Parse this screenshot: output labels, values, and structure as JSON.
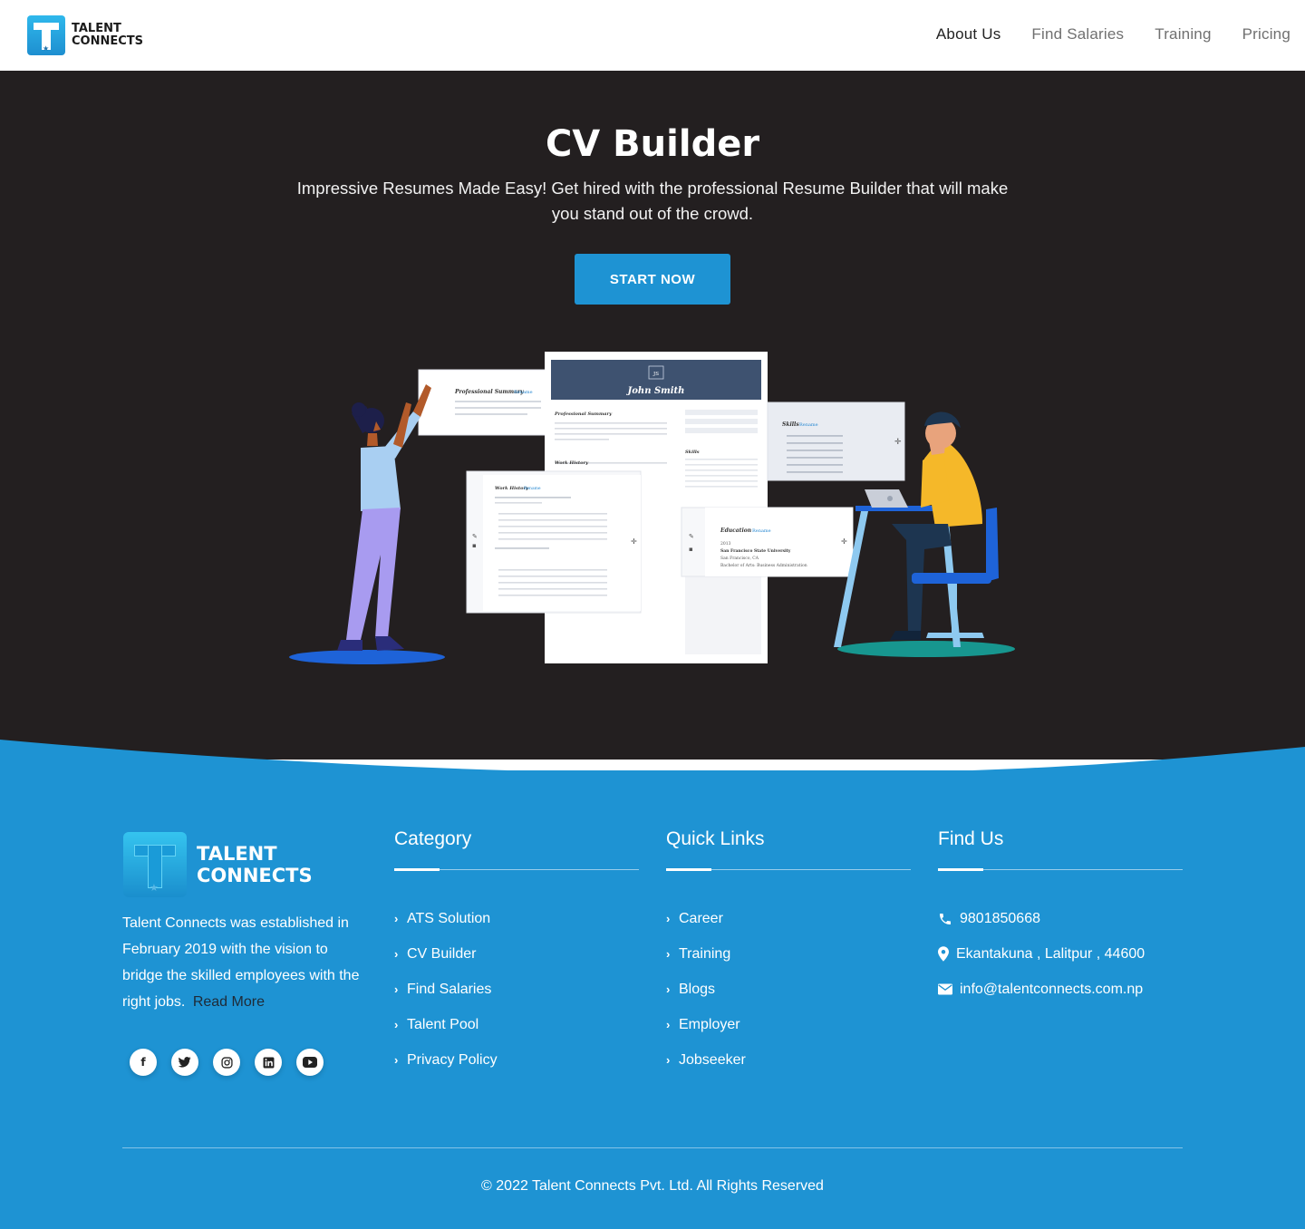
{
  "header": {
    "logo_line1": "TALENT",
    "logo_line2": "CONNECTS",
    "nav": [
      {
        "label": "About Us",
        "active": true
      },
      {
        "label": "Find Salaries",
        "active": false
      },
      {
        "label": "Training",
        "active": false
      },
      {
        "label": "Pricing",
        "active": false
      }
    ]
  },
  "hero": {
    "title": "CV Builder",
    "subtitle": "Impressive Resumes Made Easy! Get hired with the professional Resume Builder that will make you stand out of the crowd.",
    "cta_label": "START NOW",
    "illustration": {
      "resume_name": "John Smith",
      "resume_initials": "JS",
      "card_professional_summary": "Professional Summary",
      "card_rename": "Rename",
      "card_work_history": "Work History",
      "card_skills": "Skills",
      "card_education": "Education",
      "edu_year": "2013",
      "edu_school": "San Francisco State University",
      "edu_city": "San Francisco, CA",
      "edu_degree": "Bachelor of Arts: Business Administration"
    }
  },
  "footer": {
    "logo_line1": "TALENT",
    "logo_line2": "CONNECTS",
    "about_text": "Talent Connects was established in February 2019 with the vision to bridge the skilled employees with the right jobs.",
    "read_more": "Read More",
    "socials": [
      {
        "icon": "facebook-icon",
        "glyph": "f"
      },
      {
        "icon": "twitter-icon",
        "glyph": "t"
      },
      {
        "icon": "instagram-icon",
        "glyph": "◎"
      },
      {
        "icon": "linkedin-icon",
        "glyph": "in"
      },
      {
        "icon": "youtube-icon",
        "glyph": "▶"
      }
    ],
    "category": {
      "title": "Category",
      "items": [
        "ATS Solution",
        "CV Builder",
        "Find Salaries",
        "Talent Pool",
        "Privacy Policy"
      ]
    },
    "quick_links": {
      "title": "Quick Links",
      "items": [
        "Career",
        "Training",
        "Blogs",
        "Employer",
        "Jobseeker"
      ]
    },
    "find_us": {
      "title": "Find Us",
      "phone": "9801850668",
      "address": "Ekantakuna , Lalitpur , 44600",
      "email": "info@talentconnects.com.np"
    },
    "copyright": "© 2022 Talent Connects Pvt. Ltd. All Rights Reserved"
  },
  "colors": {
    "brand_blue": "#1e93d3",
    "hero_bg": "#231f20"
  }
}
